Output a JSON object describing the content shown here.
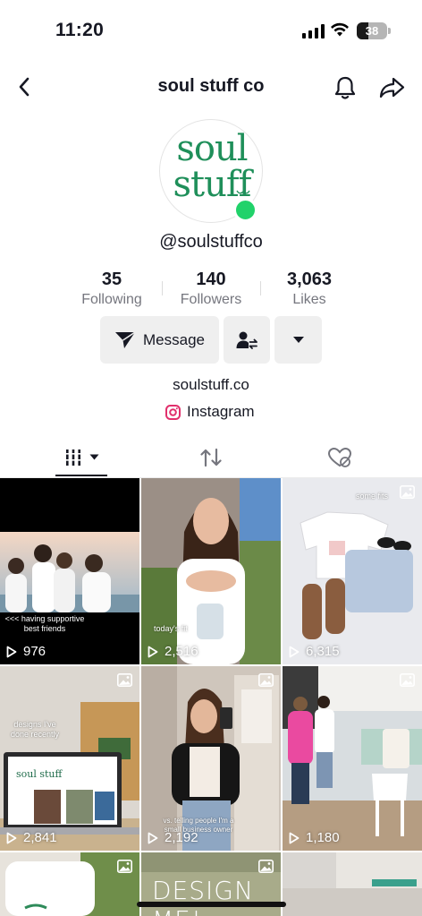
{
  "status": {
    "time": "11:20",
    "battery": "38",
    "battery_level": 0.38
  },
  "header": {
    "title": "soul stuff co"
  },
  "profile": {
    "avatar_line1": "soul",
    "avatar_line2": "stuff",
    "username": "@soulstuffco",
    "stats": [
      {
        "value": "35",
        "label": "Following"
      },
      {
        "value": "140",
        "label": "Followers"
      },
      {
        "value": "3,063",
        "label": "Likes"
      }
    ],
    "message_label": "Message",
    "bio_link": "soulstuff.co",
    "instagram_label": "Instagram"
  },
  "grid": [
    {
      "views": "976",
      "caption": "<<< having supportive\nbest friends",
      "photo": false
    },
    {
      "views": "2,516",
      "caption": "today's fit",
      "photo": false
    },
    {
      "views": "6,315",
      "caption": "some fits",
      "photo": true
    },
    {
      "views": "2,841",
      "caption": "designs I've\ndone recently",
      "photo": true,
      "screen_text": "soul stuff"
    },
    {
      "views": "2,192",
      "caption": "vs. telling people I'm a\nsmall business owner",
      "photo": true
    },
    {
      "views": "1,180",
      "caption": "",
      "photo": true
    },
    {
      "views": "",
      "caption": "",
      "photo": true
    },
    {
      "views": "",
      "caption": "DESIGN ME!",
      "photo": true
    },
    {
      "views": "",
      "caption": "",
      "photo": false
    }
  ],
  "colors": {
    "brand_green": "#1f8f5a",
    "live_green": "#21d26a",
    "instagram": "#e1306c"
  }
}
